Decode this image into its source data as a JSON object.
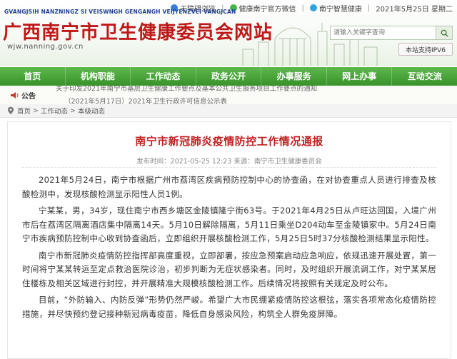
{
  "header": {
    "site_pinyin": "GVANGJSIH NANZNINGZ SI VEISWNGH GENGANGH VEIJYENZVEI VANGJCAN",
    "site_title": "广西南宁市卫生健康委员会网站",
    "site_domain": "wjw.nanning.gov.cn",
    "topbar": {
      "accessibility": "无障碍浏览",
      "wechat": "健康南宁官方微信",
      "app": "南宁智慧健康",
      "date": "2021年5月25日 星期二"
    },
    "search": {
      "placeholder": "请输入关键字查询"
    },
    "ipv6_badge": "本站支持IPV6"
  },
  "nav": {
    "items": [
      {
        "label": "首页"
      },
      {
        "label": "机构职能"
      },
      {
        "label": "工作动态"
      },
      {
        "label": "政务公开"
      },
      {
        "label": "办事服务"
      },
      {
        "label": "网上办事"
      },
      {
        "label": "互动交流"
      }
    ]
  },
  "notice": {
    "label": "公告",
    "line1": "关于印发2021年南宁市基层卫生健康工作要点及基本公共卫生服务项目工作要点的通知",
    "line2": "（2021年5月17日）2021年卫生行政许可信息公示表"
  },
  "breadcrumb": {
    "items": [
      "首页",
      "工作动态",
      "本级动态"
    ],
    "separator": ">"
  },
  "article": {
    "title": "南宁市新冠肺炎疫情防控工作情况通报",
    "meta": "发布时间：2021-05-25 12:23    来源：南宁市卫生健康委员会",
    "paragraphs": [
      "2021年5月24日，南宁市根据广州市荔湾区疾病预防控制中心的协查函，在对协查重点人员进行排查及核酸检测中，发现核酸检测显示阳性人员1例。",
      "宁某某，男，34岁，现住南宁市西乡塘区金陵镇隆宁街63号。于2021年4月25日从卢旺达回国，入境广州市后在荔湾区隔离酒店集中隔离14天。5月10日解除隔离，5月11日乘坐D204动车至金陵镇家中。5月24日南宁市疾病预防控制中心收到协查函后，立即组织开展核酸检测工作，5月25日5时37分核酸检测结果显示阳性。",
      "南宁市新冠肺炎疫情防控指挥部高度重视，立即部署，按应急预案启动应急响应，依规迅速开展处置，第一时间将宁某某转运至定点救治医院诊治，初步判断为无症状感染者。同时，及时组织开展流调工作，对宁某某居住楼栋及相关区域进行封控，并开展精准大规模核酸检测工作。后续情况将按照有关规定及时公布。",
      "目前，“外防输入、内防反弹”形势仍然严峻。希望广大市民绷紧疫情防控这根弦，落实各项常态化疫情防控措施，并尽快预约登记接种新冠病毒疫苗，降低自身感染风险，构筑全人群免疫屏障。"
    ]
  },
  "colors": {
    "title_red": "#c01818",
    "nav_green": "#37922a",
    "pinyin_blue": "#1e3f93"
  },
  "icons": [
    "accessibility-icon",
    "wechat-icon",
    "app-icon",
    "search-icon",
    "notice-horn-icon",
    "location-pin-icon"
  ]
}
